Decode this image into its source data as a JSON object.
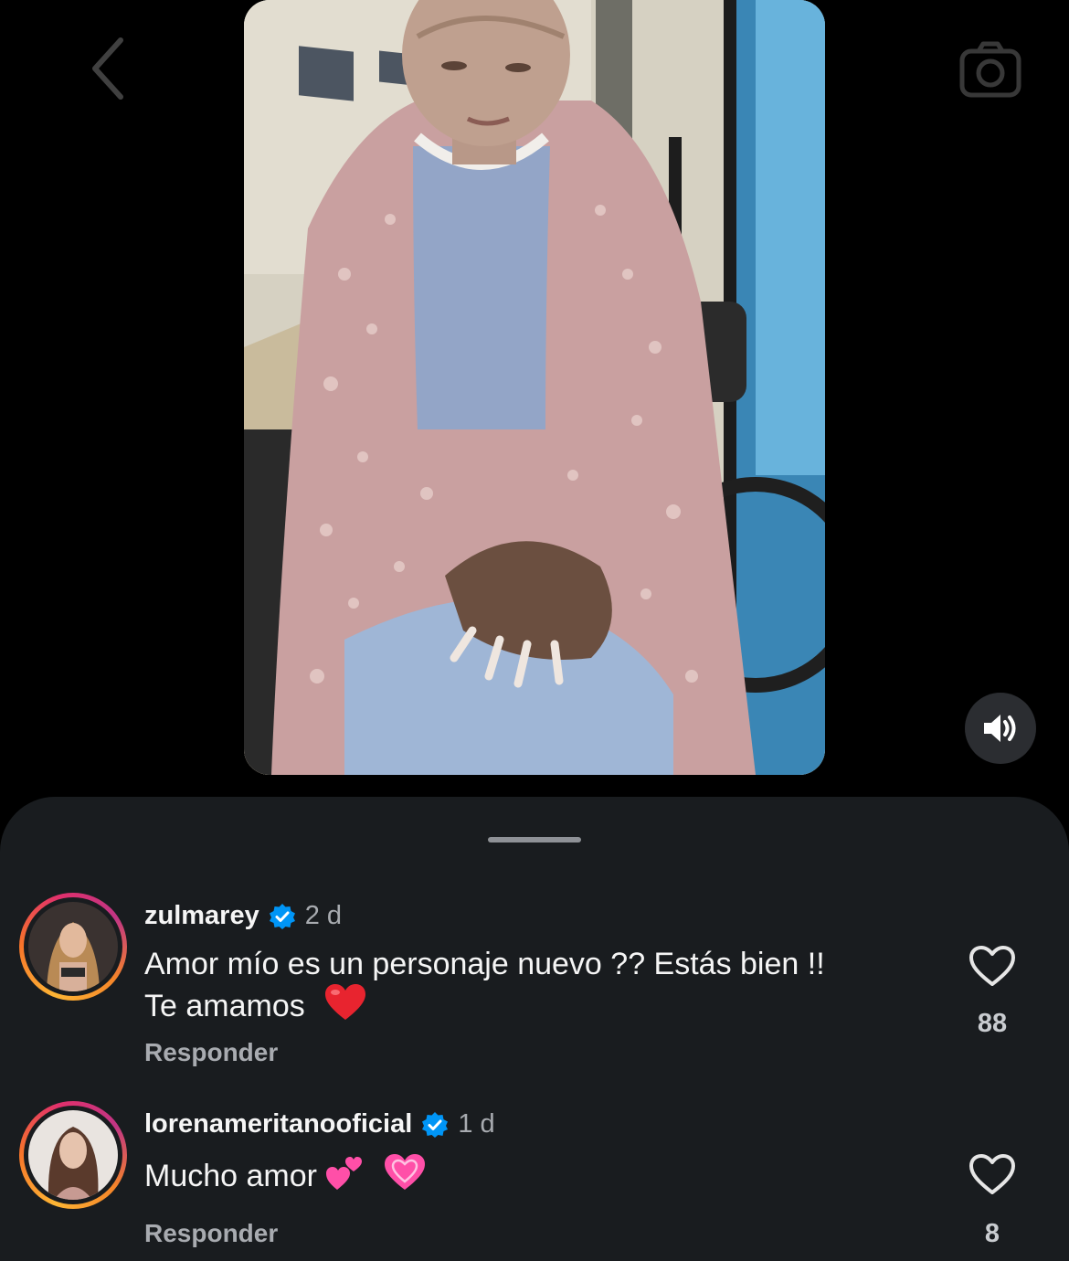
{
  "header": {
    "back_icon": "chevron-left-icon",
    "camera_icon": "camera-icon"
  },
  "video": {
    "sound_icon": "speaker-on-icon"
  },
  "comments": [
    {
      "username": "zulmarey",
      "verified": true,
      "time": "2 d",
      "text_line1": "Amor mío es un personaje nuevo ?? Estás bien !!",
      "text_line2": "Te amamos",
      "emoji": "red-heart",
      "reply_label": "Responder",
      "like_count": "88"
    },
    {
      "username": "lorenameritanooficial",
      "verified": true,
      "time": "1 d",
      "text_line1": "Mucho amor",
      "emoji": "two-hearts, growing-heart",
      "reply_label": "Responder",
      "like_count": "8"
    }
  ],
  "colors": {
    "sheet_bg": "#191c1f",
    "verified_blue": "#0095f6",
    "muted_text": "#a8abb0"
  }
}
